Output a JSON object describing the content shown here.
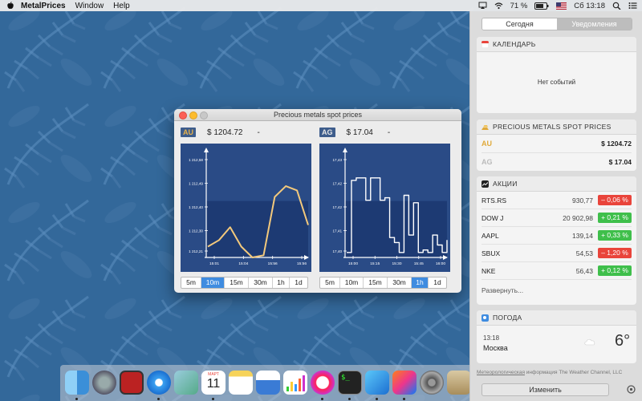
{
  "menubar": {
    "app_name": "MetalPrices",
    "menus": [
      "Window",
      "Help"
    ],
    "battery": "71 %",
    "clock": "Сб 13:18"
  },
  "window": {
    "title": "Precious metals spot prices",
    "au": {
      "tag": "AU",
      "price": "$ 1204.72",
      "change": "-",
      "y_ticks": [
        "1 212,58",
        "1 212,49",
        "1 212,40",
        "1 212,30",
        "1 212,21"
      ],
      "x_ticks": [
        "15:01",
        "15:04",
        "15:56",
        "15:56"
      ],
      "y_range": [
        1212.16,
        1212.62
      ],
      "series": [
        1212.21,
        1212.24,
        1212.3,
        1212.21,
        1212.16,
        1212.17,
        1212.44,
        1212.49,
        1212.47,
        1212.31
      ],
      "timeframes": [
        "5m",
        "10m",
        "15m",
        "30m",
        "1h",
        "1d"
      ],
      "selected": "10m"
    },
    "ag": {
      "tag": "AG",
      "price": "$ 17.04",
      "change": "-",
      "y_ticks": [
        "17,43",
        "17,42",
        "17,42",
        "17,41",
        "17,40"
      ],
      "x_ticks": [
        "15:00",
        "15:15",
        "15:30",
        "15:45",
        "16:00"
      ],
      "y_range": [
        17.398,
        17.438
      ],
      "series": [
        17.4,
        17.429,
        17.43,
        17.43,
        17.421,
        17.43,
        17.43,
        17.421,
        17.422,
        17.406,
        17.404,
        17.4,
        17.423,
        17.407,
        17.42,
        17.4,
        17.401,
        17.4,
        17.407,
        17.403,
        17.4,
        17.405
      ],
      "timeframes": [
        "5m",
        "10m",
        "15m",
        "30m",
        "1h",
        "1d"
      ],
      "selected": "1h"
    }
  },
  "notification_center": {
    "tabs": [
      "Сегодня",
      "Уведомления"
    ],
    "calendar": {
      "title": "КАЛЕНДАРЬ",
      "empty": "Нет событий"
    },
    "metals": {
      "title": "PRECIOUS METALS SPOT PRICES",
      "rows": [
        {
          "symbol": "AU",
          "price": "$ 1204.72"
        },
        {
          "symbol": "AG",
          "price": "$ 17.04"
        }
      ]
    },
    "stocks": {
      "title": "АКЦИИ",
      "rows": [
        {
          "symbol": "RTS.RS",
          "price": "930,77",
          "change": "– 0,06 %",
          "dir": "down"
        },
        {
          "symbol": "DOW J",
          "price": "20 902,98",
          "change": "+ 0,21 %",
          "dir": "up"
        },
        {
          "symbol": "AAPL",
          "price": "139,14",
          "change": "+ 0,33 %",
          "dir": "up"
        },
        {
          "symbol": "SBUX",
          "price": "54,53",
          "change": "– 1,20 %",
          "dir": "down"
        },
        {
          "symbol": "NKE",
          "price": "56,43",
          "change": "+ 0,12 %",
          "dir": "up"
        }
      ],
      "more": "Развернуть..."
    },
    "weather": {
      "title": "ПОГОДА",
      "time": "13:18",
      "city": "Москва",
      "temp": "6°",
      "footer_link": "Метеорологическая",
      "footer_rest": " информация The Weather Channel, LLC"
    },
    "edit_button": "Изменить"
  },
  "colors": {
    "accent": "#3f8ce0",
    "chart_bg": "#1e3f78",
    "gold": "#e0a93a",
    "up": "#3fbf4b",
    "down": "#e9443b"
  },
  "dock": {
    "icons": [
      "finder-icon",
      "launchpad-icon",
      "photo-booth-icon",
      "safari-icon",
      "preview-icon",
      "calendar-icon",
      "notes-icon",
      "keynote-icon",
      "numbers-icon",
      "itunes-icon",
      "terminal-icon",
      "xcode-icon",
      "intellij-icon",
      "system-preferences-icon",
      "script-editor-icon"
    ],
    "calendar_month": "МАРТ",
    "calendar_day": "11"
  }
}
